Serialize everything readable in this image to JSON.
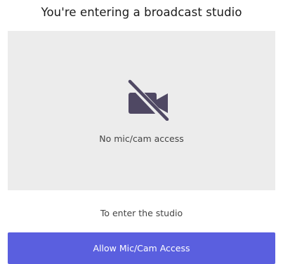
{
  "header": {
    "title": "You're entering a broadcast studio"
  },
  "preview": {
    "icon": "camera-off-icon",
    "status_text": "No mic/cam access"
  },
  "prompt": {
    "subtitle": "To enter the studio",
    "allow_button_label": "Allow Mic/Cam Access"
  },
  "colors": {
    "accent": "#5a5fdf",
    "icon": "#4f4863",
    "preview_bg": "#ececec"
  }
}
